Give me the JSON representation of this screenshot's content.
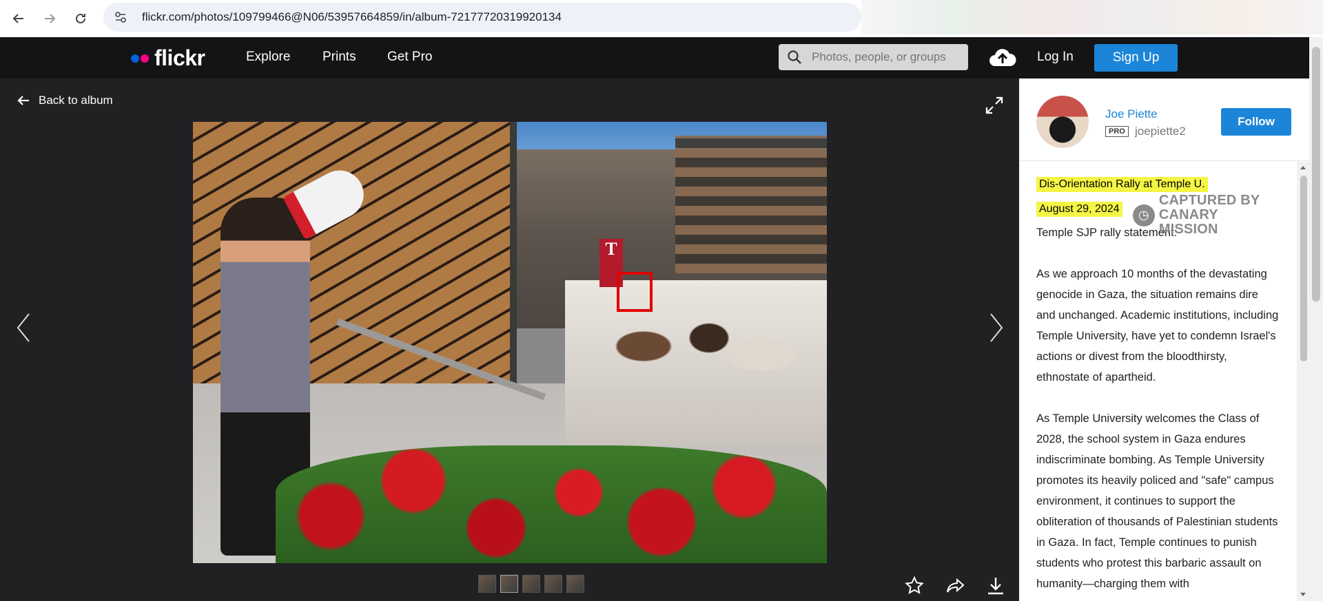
{
  "browser": {
    "url": "flickr.com/photos/109799466@N06/53957664859/in/album-72177720319920134"
  },
  "header": {
    "logo": "flickr",
    "nav": [
      "Explore",
      "Prints",
      "Get Pro"
    ],
    "search_placeholder": "Photos, people, or groups",
    "login": "Log In",
    "signup": "Sign Up"
  },
  "photo_page": {
    "back_label": "Back to album",
    "thumbnail_count": 5
  },
  "owner": {
    "name": "Joe Piette",
    "badge": "PRO",
    "username": "joepiette2",
    "follow_label": "Follow"
  },
  "description": {
    "title": "Dis-Orientation Rally at Temple U.",
    "date": "August 29, 2024",
    "watermark": [
      "CAPTURED BY",
      "CANARY MISSION"
    ],
    "paragraphs": [
      "Temple SJP rally statement:",
      "As we approach 10 months of the devastating genocide in Gaza, the situation remains dire and unchanged. Academic institutions, including Temple University, have yet to condemn Israel's actions or divest from the bloodthirsty, ethnostate of apartheid.",
      "As Temple University welcomes the Class of 2028, the school system in Gaza endures indiscriminate bombing. As Temple University promotes its heavily policed and \"safe\" campus environment, it continues to support the obliteration of thousands of Palestinian students in Gaza. In fact, Temple continues to punish students who protest this barbaric assault on humanity—charging them with"
    ]
  },
  "colors": {
    "accent": "#1c85d8",
    "highlight": "#f4f544",
    "header_bg": "#141416",
    "photo_bg": "#212124"
  }
}
